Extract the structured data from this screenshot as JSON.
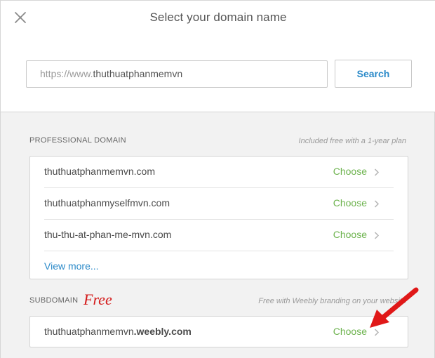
{
  "dialog": {
    "title": "Select your domain name",
    "close_icon": "close-icon"
  },
  "search": {
    "prefix": "https://www.",
    "value": "thuthuatphanmemvn",
    "button_label": "Search"
  },
  "professional": {
    "label": "PROFESSIONAL DOMAIN",
    "note": "Included free with a 1-year plan",
    "items": [
      {
        "domain": "thuthuatphanmemvn.com",
        "action": "Choose"
      },
      {
        "domain": "thuthuatphanmyselfmvn.com",
        "action": "Choose"
      },
      {
        "domain": "thu-thu-at-phan-me-mvn.com",
        "action": "Choose"
      }
    ],
    "view_more": "View more..."
  },
  "subdomain": {
    "label": "SUBDOMAIN",
    "annotation": "Free",
    "note": "Free with Weebly branding on your website",
    "name": "thuthuatphanmemvn",
    "suffix": ".weebly.com",
    "action": "Choose"
  },
  "colors": {
    "accent_blue": "#2b8ac9",
    "choose_green": "#6db34e",
    "annotation_red": "#d41a1a"
  }
}
